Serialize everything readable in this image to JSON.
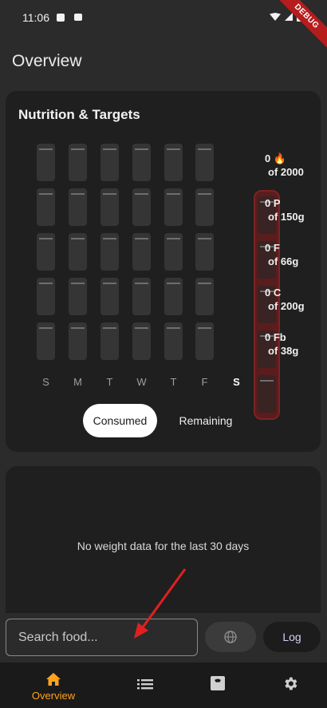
{
  "status": {
    "time": "11:06"
  },
  "debug_banner": "DEBUG",
  "page_title": "Overview",
  "nutrition": {
    "title": "Nutrition & Targets",
    "days": [
      "S",
      "M",
      "T",
      "W",
      "T",
      "F",
      "S"
    ],
    "today_index": 6,
    "macros": [
      {
        "value": "0 🔥",
        "target": "of 2000"
      },
      {
        "value": "0 P",
        "target": "of 150g"
      },
      {
        "value": "0 F",
        "target": "of 66g"
      },
      {
        "value": "0 C",
        "target": "of 200g"
      },
      {
        "value": "0 Fb",
        "target": "of 38g"
      }
    ],
    "toggle": {
      "consumed": "Consumed",
      "remaining": "Remaining",
      "selected": "Consumed"
    }
  },
  "weight": {
    "empty_message": "No weight data for the last 30 days"
  },
  "search": {
    "placeholder": "Search food...",
    "log_label": "Log"
  },
  "nav": {
    "items": [
      {
        "label": "Overview",
        "icon": "home-icon",
        "active": true
      },
      {
        "label": "",
        "icon": "list-icon",
        "active": false
      },
      {
        "label": "",
        "icon": "weight-scale-icon",
        "active": false
      },
      {
        "label": "",
        "icon": "settings-gear-icon",
        "active": false
      }
    ]
  },
  "colors": {
    "accent": "#ffa21f",
    "today_highlight": "#5a1c1c",
    "log_text": "#d6cef0",
    "annotation": "#e02020"
  }
}
